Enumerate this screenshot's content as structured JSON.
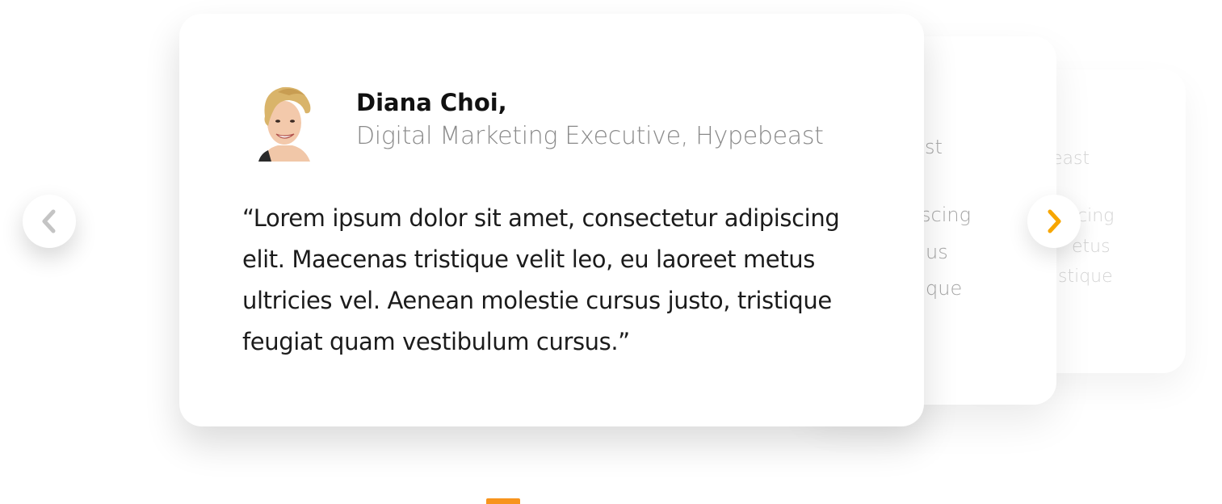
{
  "colors": {
    "accent": "#f7a600",
    "indicator": "#f7941d",
    "prev_chevron": "#c4c4c4"
  },
  "nav": {
    "prev_icon": "chevron-left-icon",
    "next_icon": "chevron-right-icon"
  },
  "testimonial": {
    "name": "Diana Choi,",
    "role": "Digital Marketing Executive, Hypebeast",
    "quote_lines": [
      "“Lorem ipsum dolor sit amet, consectetur adipiscing",
      "elit. Maecenas tristique velit leo, eu laoreet metus",
      "ultricies vel. Aenean molestie cursus justo, tristique",
      "feugiat quam vestibulum cursus.”"
    ]
  },
  "back_card_1": {
    "fragments": [
      "st",
      "scing",
      "us",
      "que"
    ]
  },
  "back_card_2": {
    "fragments": [
      "east",
      "cing",
      "etus",
      "stique"
    ]
  },
  "pagination": {
    "active_index": 0
  }
}
